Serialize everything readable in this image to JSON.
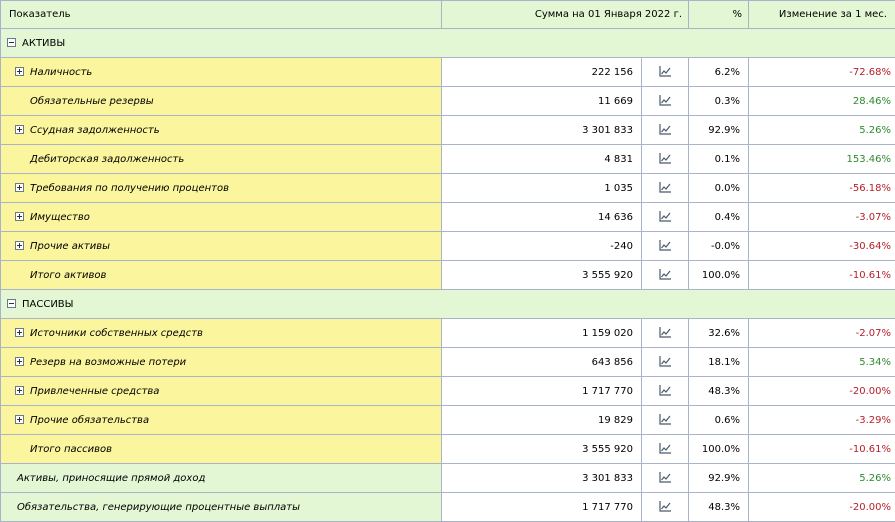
{
  "header": {
    "indicator": "Показатель",
    "sum": "Сумма на 01 Января 2022 г.",
    "percent": "%",
    "change": "Изменение за 1 мес."
  },
  "assets": {
    "title": "АКТИВЫ",
    "rows": [
      {
        "label": "Наличность",
        "sum": "222 156",
        "pct": "6.2%",
        "chg": "-72.68%",
        "expandable": true,
        "sign": "neg"
      },
      {
        "label": "Обязательные резервы",
        "sum": "11 669",
        "pct": "0.3%",
        "chg": "28.46%",
        "expandable": false,
        "sign": "pos"
      },
      {
        "label": "Ссудная задолженность",
        "sum": "3 301 833",
        "pct": "92.9%",
        "chg": "5.26%",
        "expandable": true,
        "sign": "pos"
      },
      {
        "label": "Дебиторская задолженность",
        "sum": "4 831",
        "pct": "0.1%",
        "chg": "153.46%",
        "expandable": false,
        "sign": "pos"
      },
      {
        "label": "Требования по получению процентов",
        "sum": "1 035",
        "pct": "0.0%",
        "chg": "-56.18%",
        "expandable": true,
        "sign": "neg"
      },
      {
        "label": "Имущество",
        "sum": "14 636",
        "pct": "0.4%",
        "chg": "-3.07%",
        "expandable": true,
        "sign": "neg"
      },
      {
        "label": "Прочие активы",
        "sum": "-240",
        "pct": "-0.0%",
        "chg": "-30.64%",
        "expandable": true,
        "sign": "neg"
      },
      {
        "label": "Итого активов",
        "sum": "3 555 920",
        "pct": "100.0%",
        "chg": "-10.61%",
        "expandable": false,
        "sign": "neg"
      }
    ]
  },
  "liabilities": {
    "title": "ПАССИВЫ",
    "rows": [
      {
        "label": "Источники собственных средств",
        "sum": "1 159 020",
        "pct": "32.6%",
        "chg": "-2.07%",
        "expandable": true,
        "sign": "neg"
      },
      {
        "label": "Резерв на возможные потери",
        "sum": "643 856",
        "pct": "18.1%",
        "chg": "5.34%",
        "expandable": true,
        "sign": "pos"
      },
      {
        "label": "Привлеченные средства",
        "sum": "1 717 770",
        "pct": "48.3%",
        "chg": "-20.00%",
        "expandable": true,
        "sign": "neg"
      },
      {
        "label": "Прочие обязательства",
        "sum": "19 829",
        "pct": "0.6%",
        "chg": "-3.29%",
        "expandable": true,
        "sign": "neg"
      },
      {
        "label": "Итого пассивов",
        "sum": "3 555 920",
        "pct": "100.0%",
        "chg": "-10.61%",
        "expandable": false,
        "sign": "neg"
      }
    ]
  },
  "summary": [
    {
      "label": "Активы, приносящие прямой доход",
      "sum": "3 301 833",
      "pct": "92.9%",
      "chg": "5.26%",
      "sign": "pos"
    },
    {
      "label": "Обязательства, генерирующие процентные выплаты",
      "sum": "1 717 770",
      "pct": "48.3%",
      "chg": "-20.00%",
      "sign": "neg"
    }
  ],
  "icons": {
    "toggle_expanded": "minus-box-icon",
    "toggle_collapsed": "plus-box-icon",
    "chart": "line-chart-icon"
  },
  "colors": {
    "header_bg": "#e3f7d4",
    "item_bg": "#fbf59d",
    "negative": "#b51f2a",
    "positive": "#2d8a2d",
    "border": "#a9b3c9"
  }
}
